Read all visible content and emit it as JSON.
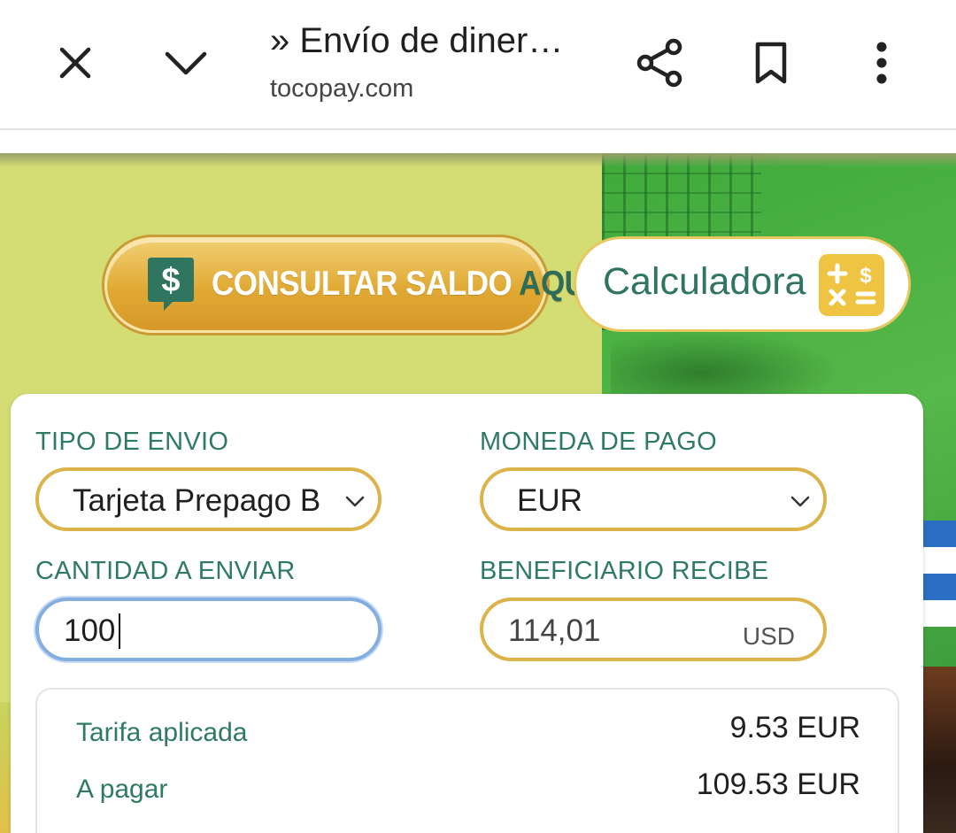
{
  "browser": {
    "title": "» Envío de diner…",
    "url": "tocopay.com",
    "close_icon": "close-icon",
    "collapse_icon": "chevron-down-icon",
    "share_icon": "share-icon",
    "bookmark_icon": "bookmark-icon",
    "menu_icon": "more-vert-icon"
  },
  "banner": {
    "saldo_button": {
      "text": "CONSULTAR SALDO ",
      "highlight": "AQUÍ",
      "icon": "dollar-chat-icon"
    },
    "calc_button": {
      "label": "Calculadora",
      "icon": "calculator-icon"
    }
  },
  "form": {
    "tipo_envio": {
      "label": "TIPO DE ENVIO",
      "value": "Tarjeta Prepago B"
    },
    "moneda_pago": {
      "label": "MONEDA DE PAGO",
      "value": "EUR"
    },
    "cantidad": {
      "label": "CANTIDAD A ENVIAR",
      "value": "100"
    },
    "beneficiario": {
      "label": "BENEFICIARIO RECIBE",
      "value": "114,01",
      "unit": "USD"
    }
  },
  "summary": {
    "tarifa": {
      "label": "Tarifa aplicada",
      "value": "9.53 EUR"
    },
    "pagar": {
      "label": "A pagar",
      "value": "109.53 EUR"
    }
  },
  "colors": {
    "accent_green": "#2f7b62",
    "gold": "#dbb34a",
    "focus_blue": "#84aedf"
  }
}
